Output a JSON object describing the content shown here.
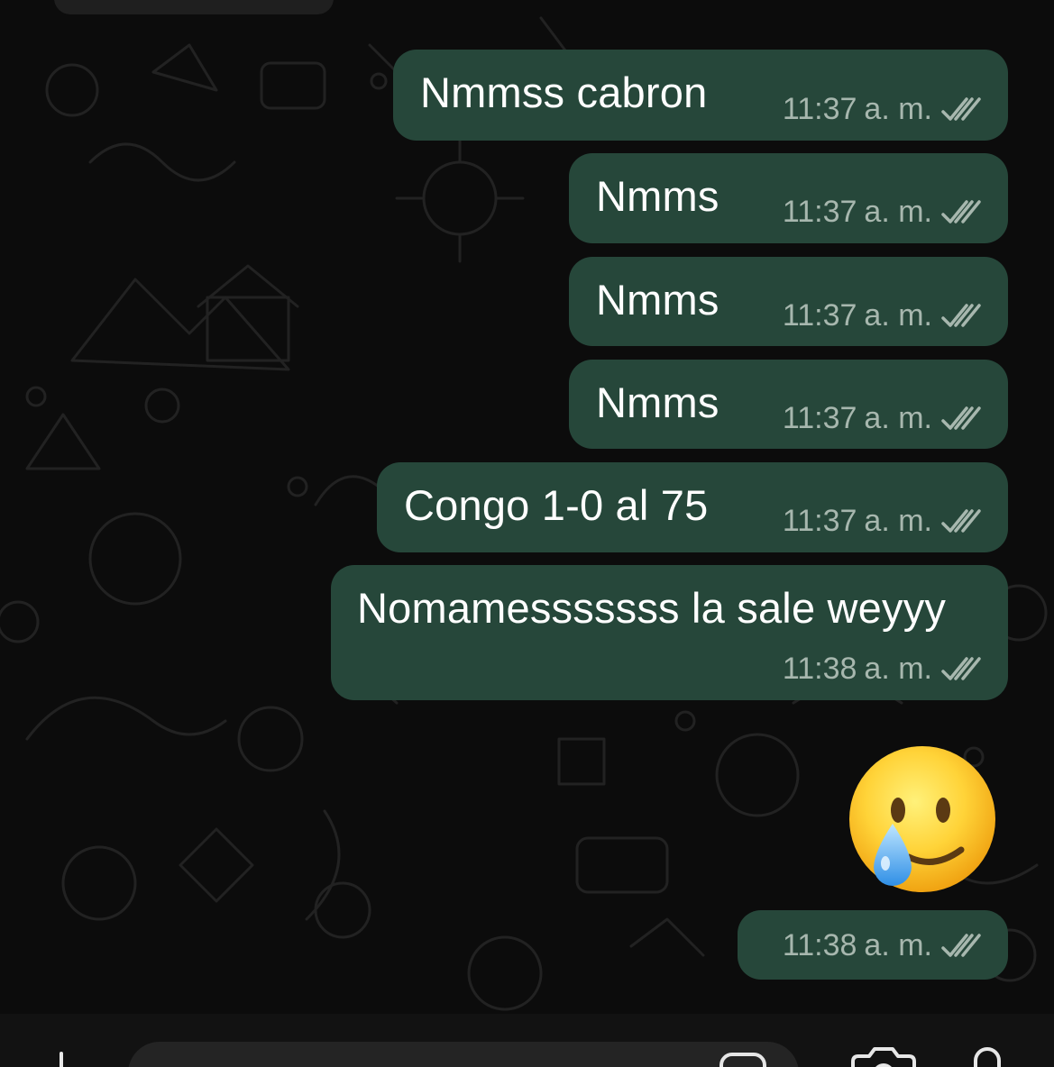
{
  "chat": {
    "messages": [
      {
        "text": "Nmmss cabron",
        "time": "11:37",
        "ampm": "a. m.",
        "status": "read"
      },
      {
        "text": "Nmms",
        "time": "11:37",
        "ampm": "a. m.",
        "status": "read"
      },
      {
        "text": "Nmms",
        "time": "11:37",
        "ampm": "a. m.",
        "status": "read"
      },
      {
        "text": "Nmms",
        "time": "11:37",
        "ampm": "a. m.",
        "status": "read"
      },
      {
        "text": "Congo 1-0 al 75",
        "time": "11:37",
        "ampm": "a. m.",
        "status": "read"
      },
      {
        "text": "Nomamesssssss la sale weyyy",
        "time": "11:38",
        "ampm": "a. m.",
        "status": "read"
      },
      {
        "emoji": "smiling-face-with-tear",
        "time": "11:38",
        "ampm": "a. m.",
        "status": "read"
      }
    ]
  },
  "composer": {
    "icons": [
      "plus-icon",
      "sticker-icon",
      "camera-icon",
      "microphone-icon"
    ]
  },
  "colors": {
    "outgoing_bubble": "#26473a",
    "meta_text": "#a7b7ae",
    "background": "#0c0c0c"
  }
}
